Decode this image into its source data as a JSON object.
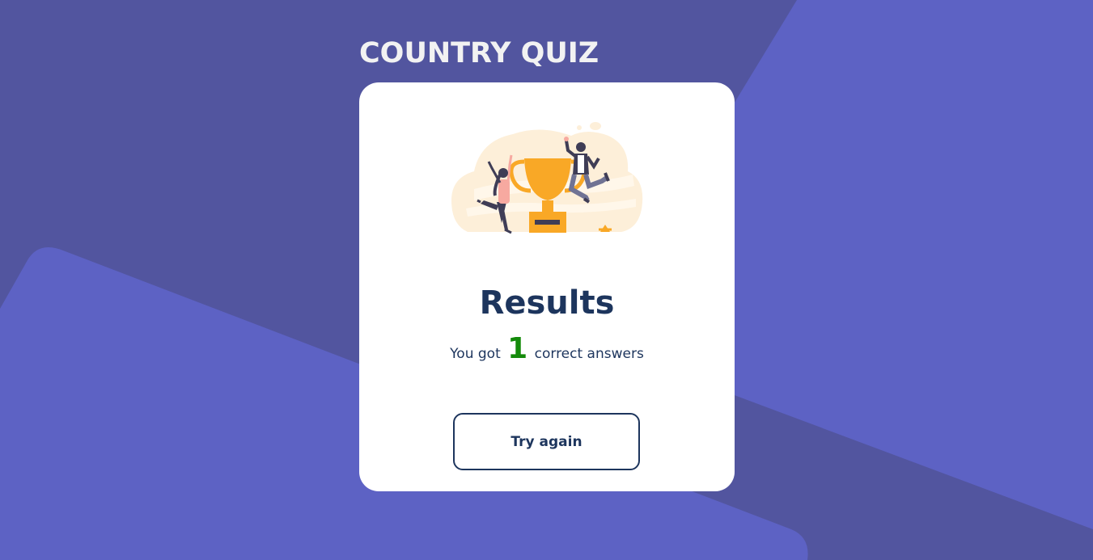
{
  "app": {
    "title": "COUNTRY QUIZ"
  },
  "colors": {
    "background_dark": "#52559f",
    "background_light": "#5d62c4",
    "card": "#ffffff",
    "heading_navy": "#1d355d",
    "score_green": "#148a0a",
    "trophy_gold": "#f9a826"
  },
  "results": {
    "illustration_icon": "winners-trophy-illustration",
    "heading": "Results",
    "score_prefix": "You got",
    "correct_count": "1",
    "score_suffix": "correct answers"
  },
  "actions": {
    "try_again_label": "Try again"
  }
}
